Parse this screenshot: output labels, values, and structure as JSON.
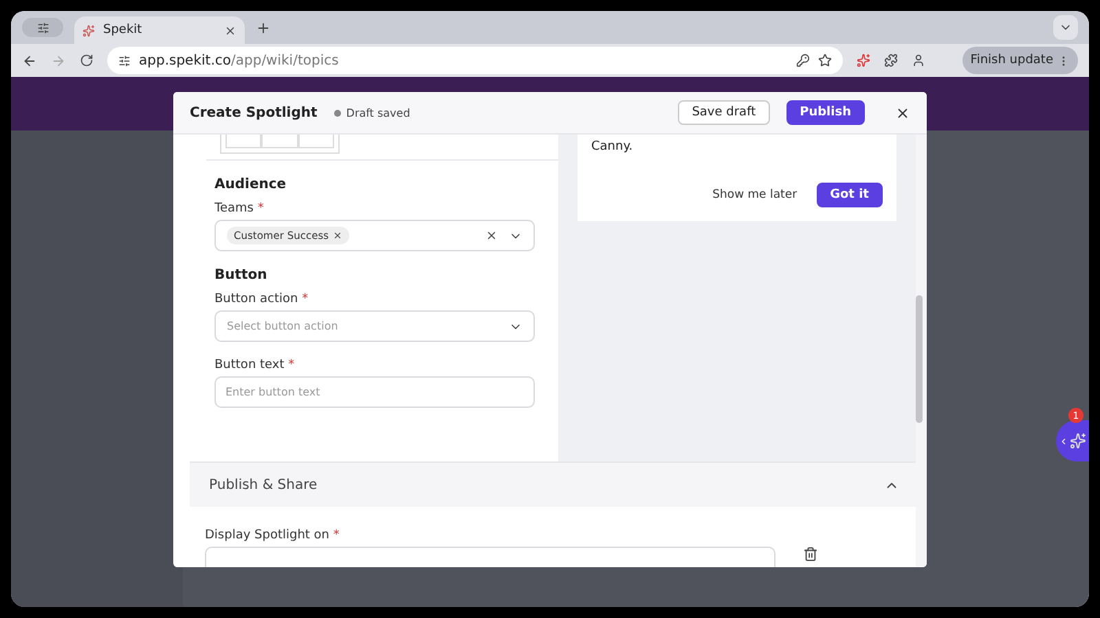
{
  "browser": {
    "tab_title": "Spekit",
    "url_host": "app.spekit.co",
    "url_path": "/app/wiki/topics",
    "update_button": "Finish update"
  },
  "modal": {
    "title": "Create Spotlight",
    "status": "Draft saved",
    "save_button": "Save draft",
    "publish_button": "Publish"
  },
  "audience": {
    "heading": "Audience",
    "teams": {
      "label": "Teams",
      "required_mark": "*",
      "tags": [
        "Customer Success"
      ]
    }
  },
  "button_section": {
    "heading": "Button",
    "action": {
      "label": "Button action",
      "required_mark": "*",
      "placeholder": "Select button action"
    },
    "text": {
      "label": "Button text",
      "required_mark": "*",
      "placeholder": "Enter button text"
    }
  },
  "preview": {
    "body": "Canny.",
    "secondary_button": "Show me later",
    "primary_button": "Got it"
  },
  "publish_share": {
    "title": "Publish & Share",
    "expanded": true,
    "display_label": "Display Spotlight on",
    "required_mark": "*"
  },
  "widget": {
    "badge": "1"
  }
}
